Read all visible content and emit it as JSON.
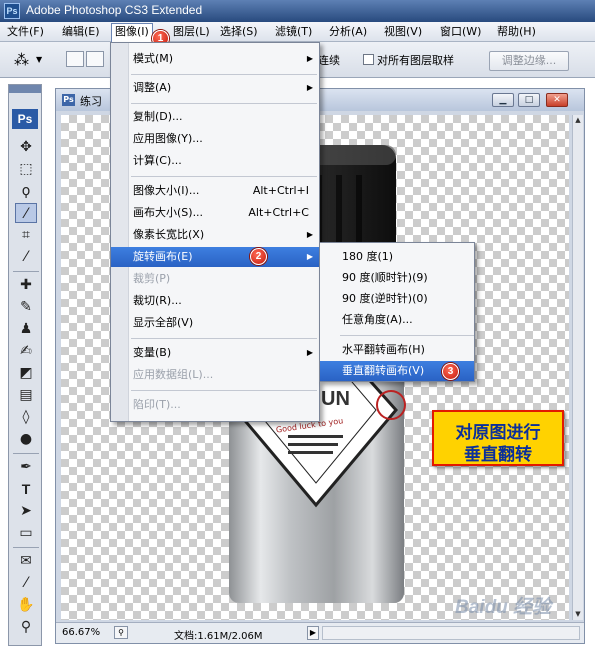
{
  "app": {
    "title": "Adobe Photoshop CS3 Extended",
    "logo": "Ps"
  },
  "menubar": {
    "items": [
      {
        "label": "文件(F)"
      },
      {
        "label": "编辑(E)"
      },
      {
        "label": "图像(I)"
      },
      {
        "label": "图层(L)"
      },
      {
        "label": "选择(S)"
      },
      {
        "label": "滤镜(T)"
      },
      {
        "label": "分析(A)"
      },
      {
        "label": "视图(V)"
      },
      {
        "label": "窗口(W)"
      },
      {
        "label": "帮助(H)"
      }
    ],
    "active": "图像(I)"
  },
  "options": {
    "snip_left": "连续",
    "sample_all_layers": "对所有图层取样",
    "refine_edge": "调整边缘..."
  },
  "document": {
    "title": "练习",
    "zoom": "66.67%",
    "docinfo": "文档:1.61M/2.06M"
  },
  "image_menu": {
    "items": [
      {
        "label": "模式(M)",
        "shortcut": "",
        "submenu": true,
        "disabled": false
      },
      {
        "label": "调整(A)",
        "shortcut": "",
        "submenu": true,
        "disabled": false
      },
      {
        "label": "复制(D)...",
        "shortcut": "",
        "submenu": false,
        "disabled": false
      },
      {
        "label": "应用图像(Y)...",
        "shortcut": "",
        "submenu": false,
        "disabled": false
      },
      {
        "label": "计算(C)...",
        "shortcut": "",
        "submenu": false,
        "disabled": false
      },
      {
        "label": "图像大小(I)...",
        "shortcut": "Alt+Ctrl+I",
        "submenu": false,
        "disabled": false
      },
      {
        "label": "画布大小(S)...",
        "shortcut": "Alt+Ctrl+C",
        "submenu": false,
        "disabled": false
      },
      {
        "label": "像素长宽比(X)",
        "shortcut": "",
        "submenu": true,
        "disabled": false
      },
      {
        "label": "旋转画布(E)",
        "shortcut": "",
        "submenu": true,
        "disabled": false,
        "highlighted": true
      },
      {
        "label": "裁剪(P)",
        "shortcut": "",
        "submenu": false,
        "disabled": true
      },
      {
        "label": "裁切(R)...",
        "shortcut": "",
        "submenu": false,
        "disabled": false
      },
      {
        "label": "显示全部(V)",
        "shortcut": "",
        "submenu": false,
        "disabled": false
      },
      {
        "label": "变量(B)",
        "shortcut": "",
        "submenu": true,
        "disabled": false
      },
      {
        "label": "应用数据组(L)...",
        "shortcut": "",
        "submenu": false,
        "disabled": true
      },
      {
        "label": "陷印(T)...",
        "shortcut": "",
        "submenu": false,
        "disabled": true
      }
    ]
  },
  "rotate_menu": {
    "items": [
      {
        "label": "180 度(1)"
      },
      {
        "label": "90 度(顺时针)(9)"
      },
      {
        "label": "90 度(逆时针)(0)"
      },
      {
        "label": "任意角度(A)..."
      },
      {
        "label": "水平翻转画布(H)"
      },
      {
        "label": "垂直翻转画布(V)"
      }
    ]
  },
  "callouts": [
    "1",
    "2",
    "3"
  ],
  "annotation": {
    "line1": "对原图进行",
    "line2": "垂直翻转"
  },
  "product_label": {
    "text1": "UN",
    "text2": "Good luck to you"
  },
  "watermark": "Baidu 经验",
  "colors": {
    "highlight": "#2a62c4",
    "callout": "#c41a0c",
    "annotation_bg": "#ffd200",
    "annotation_text": "#0b2f9a"
  }
}
